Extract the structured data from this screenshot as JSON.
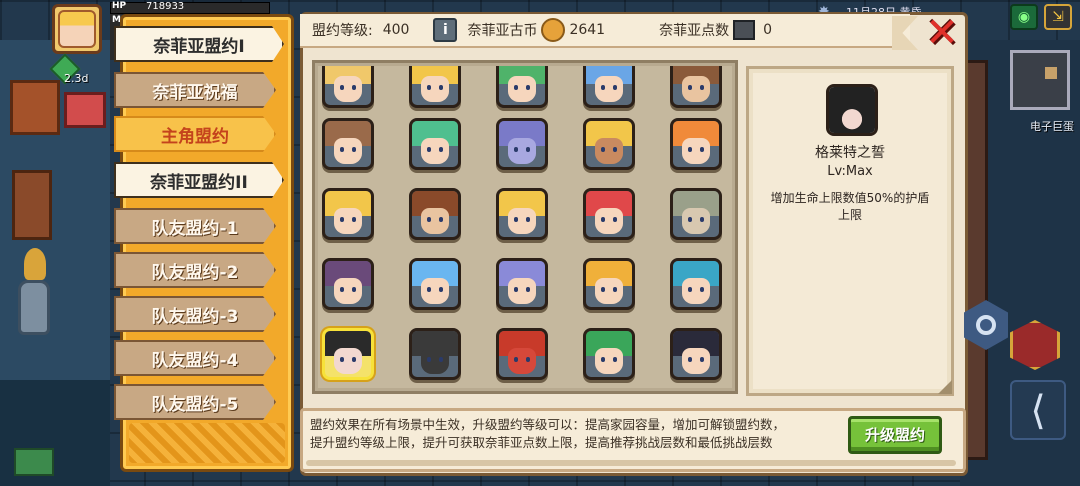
{
  "hud": {
    "hp_label": "HP",
    "hp_value": "718933",
    "mp_label": "MP",
    "level_text": "2.3d",
    "date_text": "11月28日  黄昏",
    "minimap_label": "电子巨蛋"
  },
  "tabs": [
    {
      "label": "奈菲亚盟约I",
      "state": "main"
    },
    {
      "label": "奈菲亚祝福",
      "state": "normal"
    },
    {
      "label": "主角盟约",
      "state": "active"
    },
    {
      "label": "奈菲亚盟约II",
      "state": "main"
    },
    {
      "label": "队友盟约-1",
      "state": "normal"
    },
    {
      "label": "队友盟约-2",
      "state": "normal"
    },
    {
      "label": "队友盟约-3",
      "state": "normal"
    },
    {
      "label": "队友盟约-4",
      "state": "normal"
    },
    {
      "label": "队友盟约-5",
      "state": "normal"
    }
  ],
  "header": {
    "covenant_level_label": "盟约等级:",
    "covenant_level_value": "400",
    "coin_label": "奈菲亚古币",
    "coin_value": "2641",
    "points_label": "奈菲亚点数",
    "points_value": "0"
  },
  "grid": {
    "rows": 5,
    "cols": 5,
    "selected_index": 20,
    "portraits": [
      {
        "hair": "#f0c86a",
        "skin": "#f6d6bd"
      },
      {
        "hair": "#f2c64a",
        "skin": "#f6d6bd"
      },
      {
        "hair": "#4fb36a",
        "skin": "#f6d6bd"
      },
      {
        "hair": "#6aa6e6",
        "skin": "#f6d6bd"
      },
      {
        "hair": "#8a5a3a",
        "skin": "#e9c4a0"
      },
      {
        "hair": "#9a6a4a",
        "skin": "#f6d6bd"
      },
      {
        "hair": "#4fbf8f",
        "skin": "#f6d6bd"
      },
      {
        "hair": "#7a7ac8",
        "skin": "#a8a8e0"
      },
      {
        "hair": "#f2c64a",
        "skin": "#c98a60"
      },
      {
        "hair": "#f08a3a",
        "skin": "#f6d6bd"
      },
      {
        "hair": "#f2c64a",
        "skin": "#f6d6bd"
      },
      {
        "hair": "#8a4a2a",
        "skin": "#e9c4a0"
      },
      {
        "hair": "#f2c64a",
        "skin": "#f6d6bd"
      },
      {
        "hair": "#e0484a",
        "skin": "#f6d6bd"
      },
      {
        "hair": "#9aa08a",
        "skin": "#d8c8b0"
      },
      {
        "hair": "#6a4a7a",
        "skin": "#f6d6bd"
      },
      {
        "hair": "#6ab6f0",
        "skin": "#f6d6bd"
      },
      {
        "hair": "#8a8ad8",
        "skin": "#f6d6bd"
      },
      {
        "hair": "#f0b03a",
        "skin": "#f6d6bd"
      },
      {
        "hair": "#3aa6c6",
        "skin": "#f6d6bd"
      },
      {
        "hair": "#2a2a2a",
        "skin": "#f2d8d0"
      },
      {
        "hair": "#3a3a3a",
        "skin": "#3a3a3a"
      },
      {
        "hair": "#c83a2a",
        "skin": "#d6483a"
      },
      {
        "hair": "#3aa65a",
        "skin": "#f6d6bd"
      },
      {
        "hair": "#2a2a3a",
        "skin": "#f6d6bd"
      }
    ]
  },
  "detail": {
    "name": "格莱特之誓",
    "level": "Lv:Max",
    "description": "增加生命上限数值50%的护盾上限"
  },
  "footer": {
    "text_line1": "盟约效果在所有场景中生效，升级盟约等级可以：提高家园容量，增加可解锁盟约数，",
    "text_line2": "提升盟约等级上限，提升可获取奈菲亚点数上限，提高推荐挑战层数和最低挑战层数",
    "upgrade_label": "升级盟约"
  },
  "colors": {
    "panel_gold": "#f2a92a",
    "close_red": "#e0302a",
    "upgrade_green": "#76c23a"
  }
}
